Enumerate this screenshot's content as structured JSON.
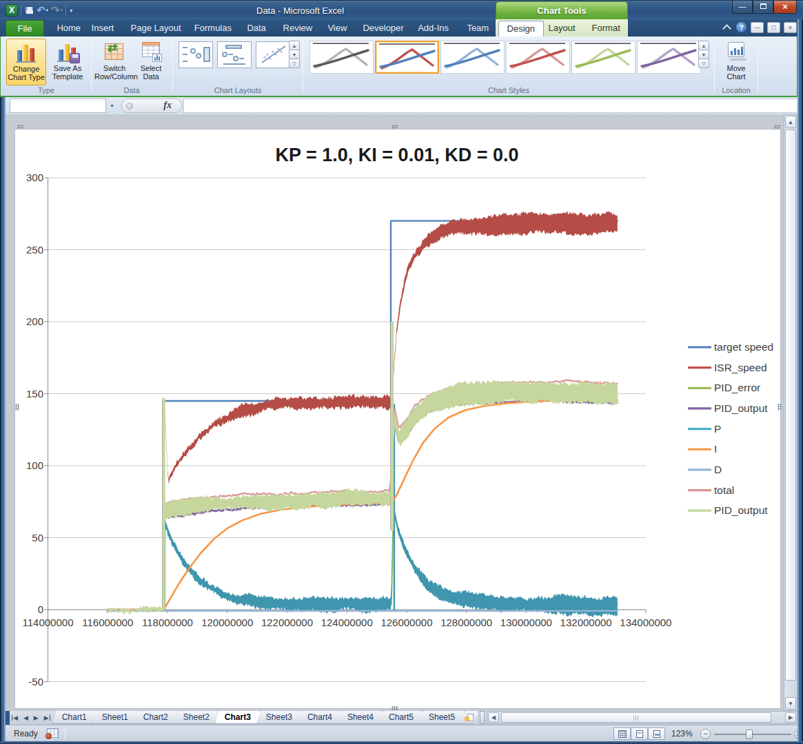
{
  "window": {
    "title": "Data  -  Microsoft Excel",
    "contextual_group": "Chart Tools"
  },
  "ribbon": {
    "tabs": [
      "File",
      "Home",
      "Insert",
      "Page Layout",
      "Formulas",
      "Data",
      "Review",
      "View",
      "Developer",
      "Add-Ins",
      "Team"
    ],
    "contextual_tabs": [
      "Design",
      "Layout",
      "Format"
    ],
    "active_tab": "Design",
    "groups": {
      "type": {
        "label": "Type",
        "buttons": [
          {
            "label1": "Change",
            "label2": "Chart Type"
          },
          {
            "label1": "Save As",
            "label2": "Template"
          }
        ]
      },
      "data": {
        "label": "Data",
        "buttons": [
          {
            "label1": "Switch",
            "label2": "Row/Column"
          },
          {
            "label1": "Select",
            "label2": "Data"
          }
        ]
      },
      "chart_layouts": {
        "label": "Chart Layouts"
      },
      "chart_styles": {
        "label": "Chart Styles",
        "styles": [
          {
            "name": "style-gray",
            "light": "#b3b3b3",
            "dark": "#595959",
            "selected": false
          },
          {
            "name": "style-red-blue",
            "light": "#C0504D",
            "dark": "#4F81BD",
            "selected": true
          },
          {
            "name": "style-blue",
            "light": "#95B3D7",
            "dark": "#4F81BD",
            "selected": false
          },
          {
            "name": "style-red",
            "light": "#D99694",
            "dark": "#C0504D",
            "selected": false
          },
          {
            "name": "style-green",
            "light": "#C3D69B",
            "dark": "#9BBB59",
            "selected": false
          },
          {
            "name": "style-purple",
            "light": "#B2A2C7",
            "dark": "#8064A2",
            "selected": false
          }
        ]
      },
      "location": {
        "label": "Location",
        "buttons": [
          {
            "label1": "Move",
            "label2": "Chart"
          }
        ]
      }
    }
  },
  "formula_bar": {
    "name_box_value": "",
    "formula_value": "",
    "fx_label": "fx"
  },
  "chart_data": {
    "type": "line",
    "title": "KP = 1.0, KI = 0.01, KD = 0.0",
    "x_ticks": [
      114000000,
      116000000,
      118000000,
      120000000,
      122000000,
      124000000,
      126000000,
      128000000,
      130000000,
      132000000,
      134000000
    ],
    "y_ticks": [
      -50,
      0,
      50,
      100,
      150,
      200,
      250,
      300
    ],
    "x_range": [
      114000000,
      134000000
    ],
    "y_range": [
      -50,
      300
    ],
    "grid": true,
    "legend_position": "right",
    "series": [
      {
        "name": "target speed",
        "color": "#4F81BD",
        "kind": "line",
        "width": 2.3,
        "anchors": [
          [
            115950000,
            0
          ],
          [
            117870000,
            0
          ],
          [
            117870000,
            145
          ],
          [
            125470000,
            145
          ],
          [
            125470000,
            270
          ],
          [
            133080000,
            270
          ]
        ]
      },
      {
        "name": "ISR_speed",
        "color": "#C0504D",
        "fill": "#b54c46",
        "kind": "band",
        "noise": 1.3,
        "seed": 11,
        "anchors": [
          [
            117880000,
            147
          ],
          [
            117950000,
            121
          ],
          [
            118020000,
            88
          ],
          [
            118300000,
            99
          ],
          [
            118600000,
            109
          ],
          [
            119000000,
            119
          ],
          [
            119500000,
            128
          ],
          [
            120000000,
            134
          ],
          [
            120600000,
            139
          ],
          [
            121300000,
            142
          ],
          [
            122200000,
            143.5
          ],
          [
            123500000,
            144
          ],
          [
            125490000,
            144.5
          ],
          [
            125520000,
            152
          ],
          [
            125650000,
            192
          ],
          [
            125800000,
            215
          ],
          [
            125950000,
            230
          ],
          [
            126100000,
            240
          ],
          [
            126250000,
            246
          ],
          [
            126450000,
            252
          ],
          [
            126700000,
            257
          ],
          [
            127000000,
            261
          ],
          [
            127600000,
            265
          ],
          [
            128400000,
            267.5
          ],
          [
            129500000,
            269
          ],
          [
            131000000,
            269
          ],
          [
            133080000,
            268
          ]
        ],
        "halfwidth": [
          [
            117880000,
            1.5
          ],
          [
            118500000,
            2
          ],
          [
            120000000,
            3
          ],
          [
            121500000,
            4
          ],
          [
            123000000,
            4.7
          ],
          [
            125490000,
            4.7
          ],
          [
            125600000,
            2.5
          ],
          [
            126300000,
            2.5
          ],
          [
            127000000,
            3.5
          ],
          [
            128000000,
            5
          ],
          [
            129000000,
            6.5
          ],
          [
            130000000,
            7
          ],
          [
            133080000,
            7
          ]
        ]
      },
      {
        "name": "PID_error",
        "color": "#9BBB59",
        "kind": "line",
        "width": 2,
        "anchors": [
          [
            117880000,
            62
          ],
          [
            118050000,
            53
          ],
          [
            118300000,
            42
          ],
          [
            118650000,
            31
          ],
          [
            119100000,
            21
          ],
          [
            119600000,
            13.5
          ],
          [
            120200000,
            8.5
          ],
          [
            121000000,
            5.5
          ],
          [
            122000000,
            4
          ],
          [
            123500000,
            3.5
          ],
          [
            125490000,
            3.5
          ],
          [
            125560000,
            70
          ],
          [
            125700000,
            56
          ],
          [
            125950000,
            40
          ],
          [
            126300000,
            27
          ],
          [
            126700000,
            17
          ],
          [
            127200000,
            11
          ],
          [
            127900000,
            7.5
          ],
          [
            128800000,
            5.5
          ],
          [
            130000000,
            4.5
          ],
          [
            131500000,
            4.2
          ],
          [
            133080000,
            4.2
          ]
        ]
      },
      {
        "name": "PID_output",
        "color": "#8064A2",
        "kind": "line",
        "width": 3,
        "jitter": 1.3,
        "seed": 21,
        "anchors": [
          [
            117900000,
            64.7
          ],
          [
            118500000,
            66.5
          ],
          [
            119500000,
            68.5
          ],
          [
            120500000,
            69.9
          ],
          [
            122000000,
            71.2
          ],
          [
            123500000,
            72.2
          ],
          [
            125000000,
            72.7
          ],
          [
            125450000,
            72.7
          ],
          [
            125600000,
            129.2
          ],
          [
            125750000,
            115.2
          ],
          [
            126000000,
            120.2
          ],
          [
            126300000,
            130.2
          ],
          [
            126700000,
            136.2
          ],
          [
            127200000,
            140.7
          ],
          [
            128000000,
            143.2
          ],
          [
            129000000,
            144.7
          ],
          [
            130500000,
            145.2
          ],
          [
            133080000,
            144.2
          ]
        ],
        "spikes": [
          {
            "x": 117855000,
            "v0": 0,
            "v1": 146,
            "w": 3
          },
          {
            "x": 125490000,
            "v0": 55,
            "v1": 198,
            "w": 3
          }
        ]
      },
      {
        "name": "P",
        "color": "#4BACC6",
        "fill": "#3f96ae",
        "kind": "band",
        "noise": 1.25,
        "seed": 31,
        "anchors": [
          [
            117880000,
            62
          ],
          [
            118050000,
            53
          ],
          [
            118300000,
            42
          ],
          [
            118650000,
            31
          ],
          [
            119100000,
            21
          ],
          [
            119600000,
            13.5
          ],
          [
            120200000,
            8.5
          ],
          [
            121000000,
            5.5
          ],
          [
            122000000,
            4
          ],
          [
            123500000,
            3.5
          ],
          [
            125490000,
            3.5
          ],
          [
            125560000,
            70
          ],
          [
            125700000,
            56
          ],
          [
            125950000,
            40
          ],
          [
            126300000,
            27
          ],
          [
            126700000,
            17
          ],
          [
            127200000,
            11
          ],
          [
            127900000,
            7.5
          ],
          [
            128800000,
            5.5
          ],
          [
            130000000,
            4
          ],
          [
            131500000,
            3
          ],
          [
            133080000,
            2.5
          ]
        ],
        "halfwidth": [
          [
            117880000,
            2
          ],
          [
            119000000,
            3
          ],
          [
            120500000,
            3.5
          ],
          [
            122000000,
            3.8
          ],
          [
            125490000,
            3.8
          ],
          [
            125560000,
            2
          ],
          [
            126500000,
            3
          ],
          [
            127500000,
            3.5
          ],
          [
            129000000,
            4.5
          ],
          [
            131000000,
            5.2
          ],
          [
            133080000,
            5.6
          ]
        ],
        "spikes": [
          {
            "x": 117905000,
            "v0": 0,
            "v1": 62,
            "w": 2.6
          },
          {
            "x": 125585000,
            "v0": -0.5,
            "v1": 143,
            "w": 2.4
          }
        ]
      },
      {
        "name": "I",
        "color": "#F79646",
        "kind": "line",
        "width": 2.6,
        "anchors": [
          [
            115950000,
            0
          ],
          [
            117880000,
            0
          ],
          [
            118100000,
            8
          ],
          [
            118350000,
            17
          ],
          [
            118700000,
            28
          ],
          [
            119100000,
            39
          ],
          [
            119550000,
            49
          ],
          [
            120000000,
            56.5
          ],
          [
            120500000,
            62
          ],
          [
            121100000,
            66.5
          ],
          [
            121800000,
            69.5
          ],
          [
            122700000,
            71.5
          ],
          [
            123800000,
            73
          ],
          [
            125000000,
            74
          ],
          [
            125490000,
            74.3
          ],
          [
            125650000,
            79
          ],
          [
            125900000,
            90
          ],
          [
            126200000,
            103
          ],
          [
            126550000,
            116
          ],
          [
            126950000,
            126
          ],
          [
            127400000,
            133.5
          ],
          [
            127950000,
            138.5
          ],
          [
            128600000,
            141.5
          ],
          [
            129400000,
            143.5
          ],
          [
            130400000,
            144.8
          ],
          [
            131500000,
            145.3
          ],
          [
            133080000,
            145.6
          ]
        ]
      },
      {
        "name": "D",
        "color": "#95B3D7",
        "kind": "line",
        "width": 2.4,
        "anchors": [
          [
            115950000,
            -0.8
          ],
          [
            133080000,
            -0.8
          ]
        ]
      },
      {
        "name": "total",
        "color": "#D99694",
        "kind": "line",
        "width": 2.2,
        "jitter": 1.4,
        "seed": 41,
        "anchors": [
          [
            117900000,
            73.3
          ],
          [
            118500000,
            75.3
          ],
          [
            119500000,
            77.3
          ],
          [
            120500000,
            79.3
          ],
          [
            122000000,
            80.8
          ],
          [
            123500000,
            81.8
          ],
          [
            125000000,
            82.3
          ],
          [
            125450000,
            82.3
          ],
          [
            125600000,
            138.8
          ],
          [
            125750000,
            125.8
          ],
          [
            126000000,
            131.8
          ],
          [
            126300000,
            141.8
          ],
          [
            126700000,
            148.1
          ],
          [
            127200000,
            153.1
          ],
          [
            128000000,
            156.8
          ],
          [
            129000000,
            158.3
          ],
          [
            130500000,
            158.8
          ],
          [
            133080000,
            157.8
          ]
        ]
      },
      {
        "name": "PID_output",
        "color": "#C3D69B",
        "fill": "#c6d79e",
        "kind": "band",
        "noise": 1.3,
        "seed": 51,
        "anchors": [
          [
            115950000,
            0
          ],
          [
            117865000,
            0
          ],
          [
            117880000,
            69
          ],
          [
            118500000,
            71
          ],
          [
            119500000,
            73
          ],
          [
            120500000,
            74.5
          ],
          [
            122000000,
            76
          ],
          [
            123500000,
            77
          ],
          [
            125000000,
            77.5
          ],
          [
            125450000,
            77.5
          ],
          [
            125600000,
            134
          ],
          [
            125750000,
            120
          ],
          [
            126000000,
            126
          ],
          [
            126300000,
            136
          ],
          [
            126700000,
            142
          ],
          [
            127200000,
            147
          ],
          [
            128000000,
            150
          ],
          [
            129000000,
            151.5
          ],
          [
            130500000,
            152
          ],
          [
            133080000,
            151
          ]
        ],
        "halfwidth": [
          [
            115950000,
            0.5
          ],
          [
            117865000,
            0.5
          ],
          [
            117880000,
            4.5
          ],
          [
            120000000,
            5
          ],
          [
            122000000,
            5
          ],
          [
            125450000,
            5
          ],
          [
            125600000,
            5
          ],
          [
            126000000,
            6
          ],
          [
            127000000,
            6.5
          ],
          [
            128000000,
            7
          ],
          [
            133080000,
            7
          ]
        ],
        "spikes": [
          {
            "x": 117875000,
            "v0": 0,
            "v1": 147,
            "w": 4.2
          },
          {
            "x": 125515000,
            "v0": 55,
            "v1": 200,
            "w": 4.6
          }
        ]
      }
    ]
  },
  "sheet_tabs": {
    "tabs": [
      "Chart1",
      "Sheet1",
      "Chart2",
      "Sheet2",
      "Chart3",
      "Sheet3",
      "Chart4",
      "Sheet4",
      "Chart5",
      "Sheet5"
    ],
    "active": "Chart3"
  },
  "status_bar": {
    "mode": "Ready",
    "zoom_level": "123%"
  }
}
